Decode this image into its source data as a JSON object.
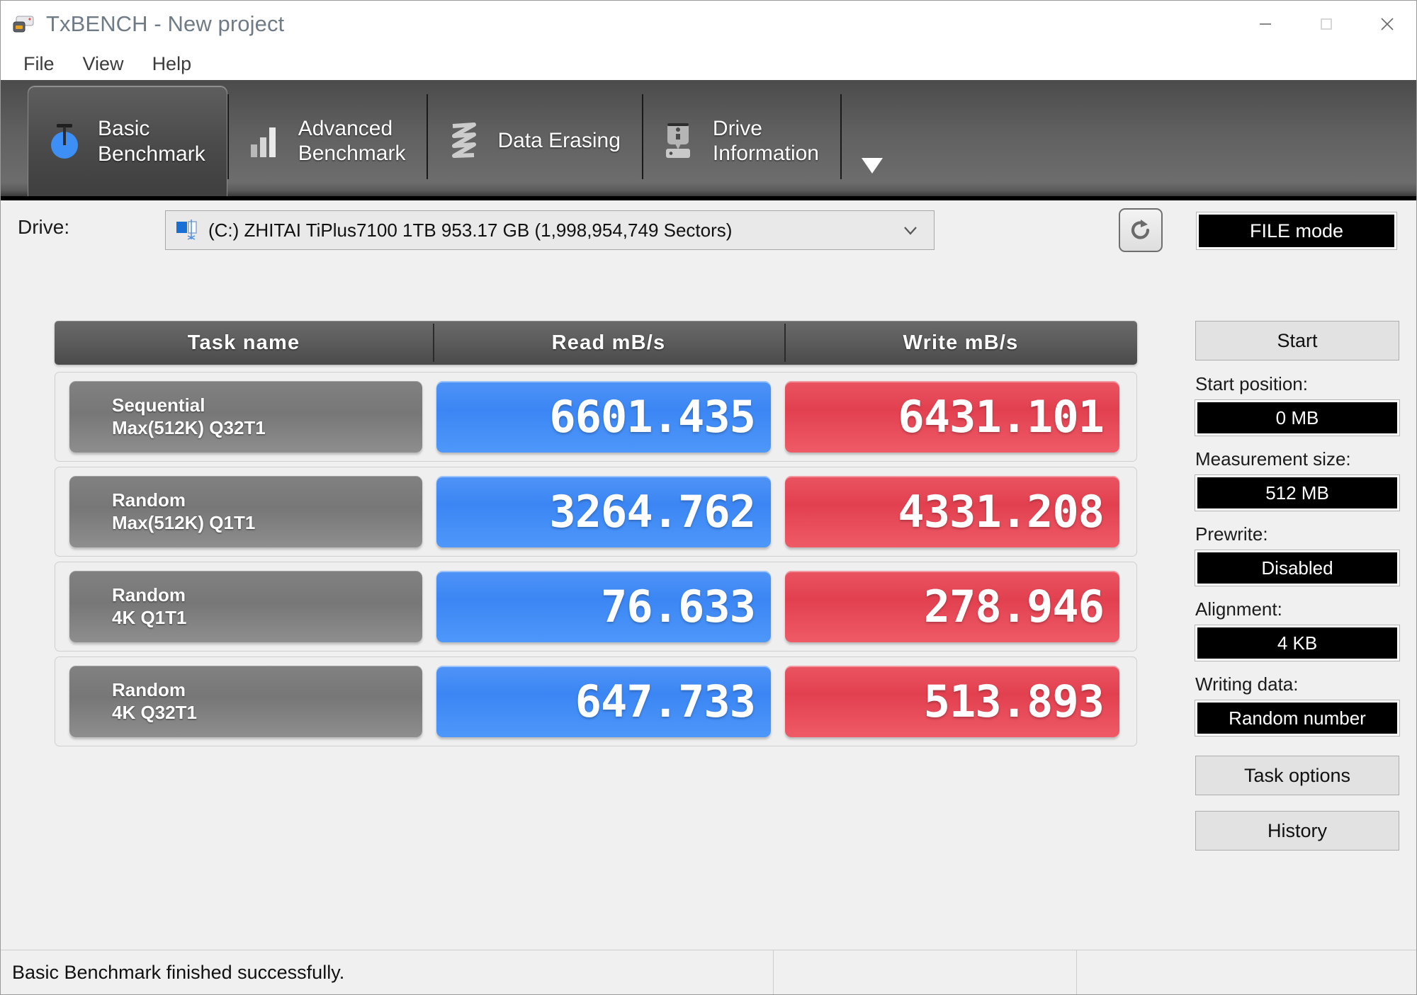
{
  "window": {
    "title": "TxBENCH - New project",
    "app_icon": "drive-device-icon",
    "controls": [
      {
        "name": "minimize",
        "glyph": "—"
      },
      {
        "name": "maximize",
        "glyph": "□"
      },
      {
        "name": "close",
        "glyph": "✕"
      }
    ]
  },
  "menu": {
    "items": [
      {
        "label": "File"
      },
      {
        "label": "View"
      },
      {
        "label": "Help"
      }
    ]
  },
  "toolbar": {
    "tabs": [
      {
        "label": "Basic\nBenchmark",
        "icon": "stopwatch-icon",
        "active": true
      },
      {
        "label": "Advanced\nBenchmark",
        "icon": "bar-chart-icon",
        "active": false
      },
      {
        "label": "Data Erasing",
        "icon": "shredder-icon",
        "active": false
      },
      {
        "label": "Drive\nInformation",
        "icon": "drive-info-icon",
        "active": false
      }
    ],
    "overflow_caret": "▼"
  },
  "drive": {
    "label": "Drive:",
    "selected": "(C:) ZHITAI TiPlus7100 1TB  953.17 GB (1,998,954,749 Sectors)",
    "icon": "hard-disk-icon",
    "caret": "⌄",
    "refresh_icon": "refresh-icon",
    "mode_badge": "FILE mode"
  },
  "results": {
    "columns": [
      "Task name",
      "Read mB/s",
      "Write mB/s"
    ],
    "rows": [
      {
        "task_line1": "Sequential",
        "task_line2": "Max(512K) Q32T1",
        "read": "6601.435",
        "write": "6431.101"
      },
      {
        "task_line1": "Random",
        "task_line2": "Max(512K) Q1T1",
        "read": "3264.762",
        "write": "4331.208"
      },
      {
        "task_line1": "Random",
        "task_line2": "4K Q1T1",
        "read": "76.633",
        "write": "278.946"
      },
      {
        "task_line1": "Random",
        "task_line2": "4K Q32T1",
        "read": "647.733",
        "write": "513.893"
      }
    ]
  },
  "sidebar": {
    "start_button": "Start",
    "fields": [
      {
        "label": "Start position:",
        "value": "0 MB"
      },
      {
        "label": "Measurement size:",
        "value": "512 MB"
      },
      {
        "label": "Prewrite:",
        "value": "Disabled"
      },
      {
        "label": "Alignment:",
        "value": "4 KB"
      },
      {
        "label": "Writing data:",
        "value": "Random number"
      }
    ],
    "task_options_button": "Task options",
    "history_button": "History"
  },
  "statusbar": {
    "message": "Basic Benchmark finished successfully.",
    "pane2": "",
    "pane3": ""
  },
  "colors": {
    "read_blue": "#3b86f4",
    "write_red": "#e2404f",
    "task_gray": "#777777",
    "toolbar_dark": "#606060",
    "accent_icon_blue": "#3d8ef5"
  }
}
